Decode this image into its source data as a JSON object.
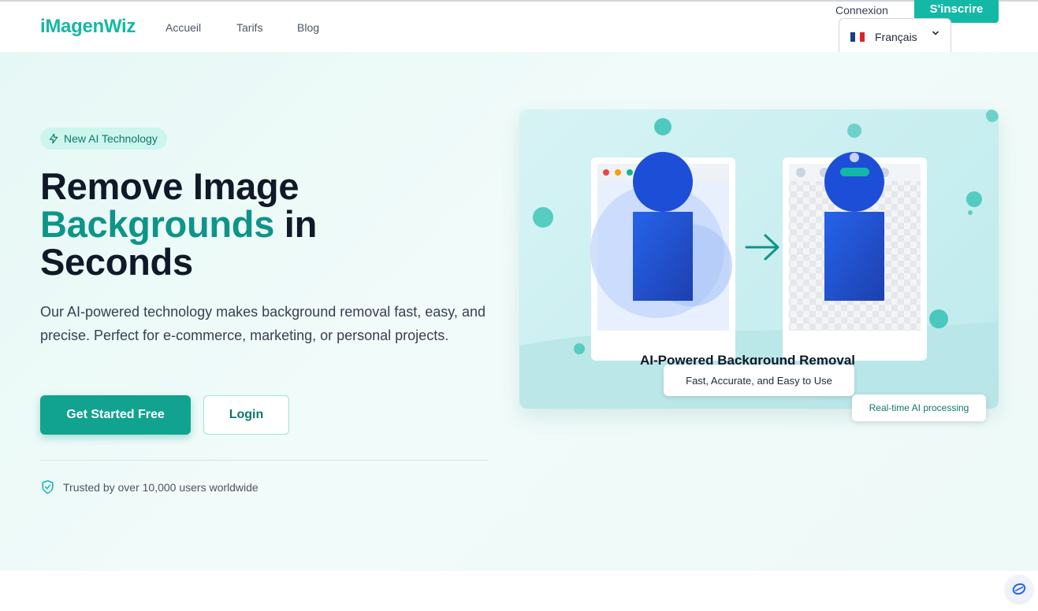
{
  "header": {
    "logo": "iMagenWiz",
    "nav": [
      "Accueil",
      "Tarifs",
      "Blog"
    ],
    "login": "Connexion",
    "signup": "S'inscrire",
    "language": "Français"
  },
  "hero": {
    "badge": "New AI Technology",
    "title_line1": "Remove Image",
    "title_accent": "Backgrounds",
    "title_after_accent": " in",
    "title_line3": "Seconds",
    "lead": "Our AI-powered technology makes background removal fast, easy, and precise. Perfect for e-commerce, marketing, or personal projects.",
    "cta_primary": "Get Started Free",
    "cta_secondary": "Login",
    "trust": "Trusted by over 10,000 users worldwide"
  },
  "illustration": {
    "title": "AI-Powered Background Removal",
    "subtitle": "Fast, Accurate, and Easy to Use",
    "badge": "Real-time AI processing"
  },
  "colors": {
    "brand": "#14b8a6",
    "accent_text": "#0f9488",
    "figure_blue": "#1d4ed8"
  },
  "icons": [
    "flag-fr-icon",
    "chevron-down-icon",
    "lightning-icon",
    "shield-check-icon",
    "arrow-right-icon",
    "chat-bubble-icon"
  ]
}
